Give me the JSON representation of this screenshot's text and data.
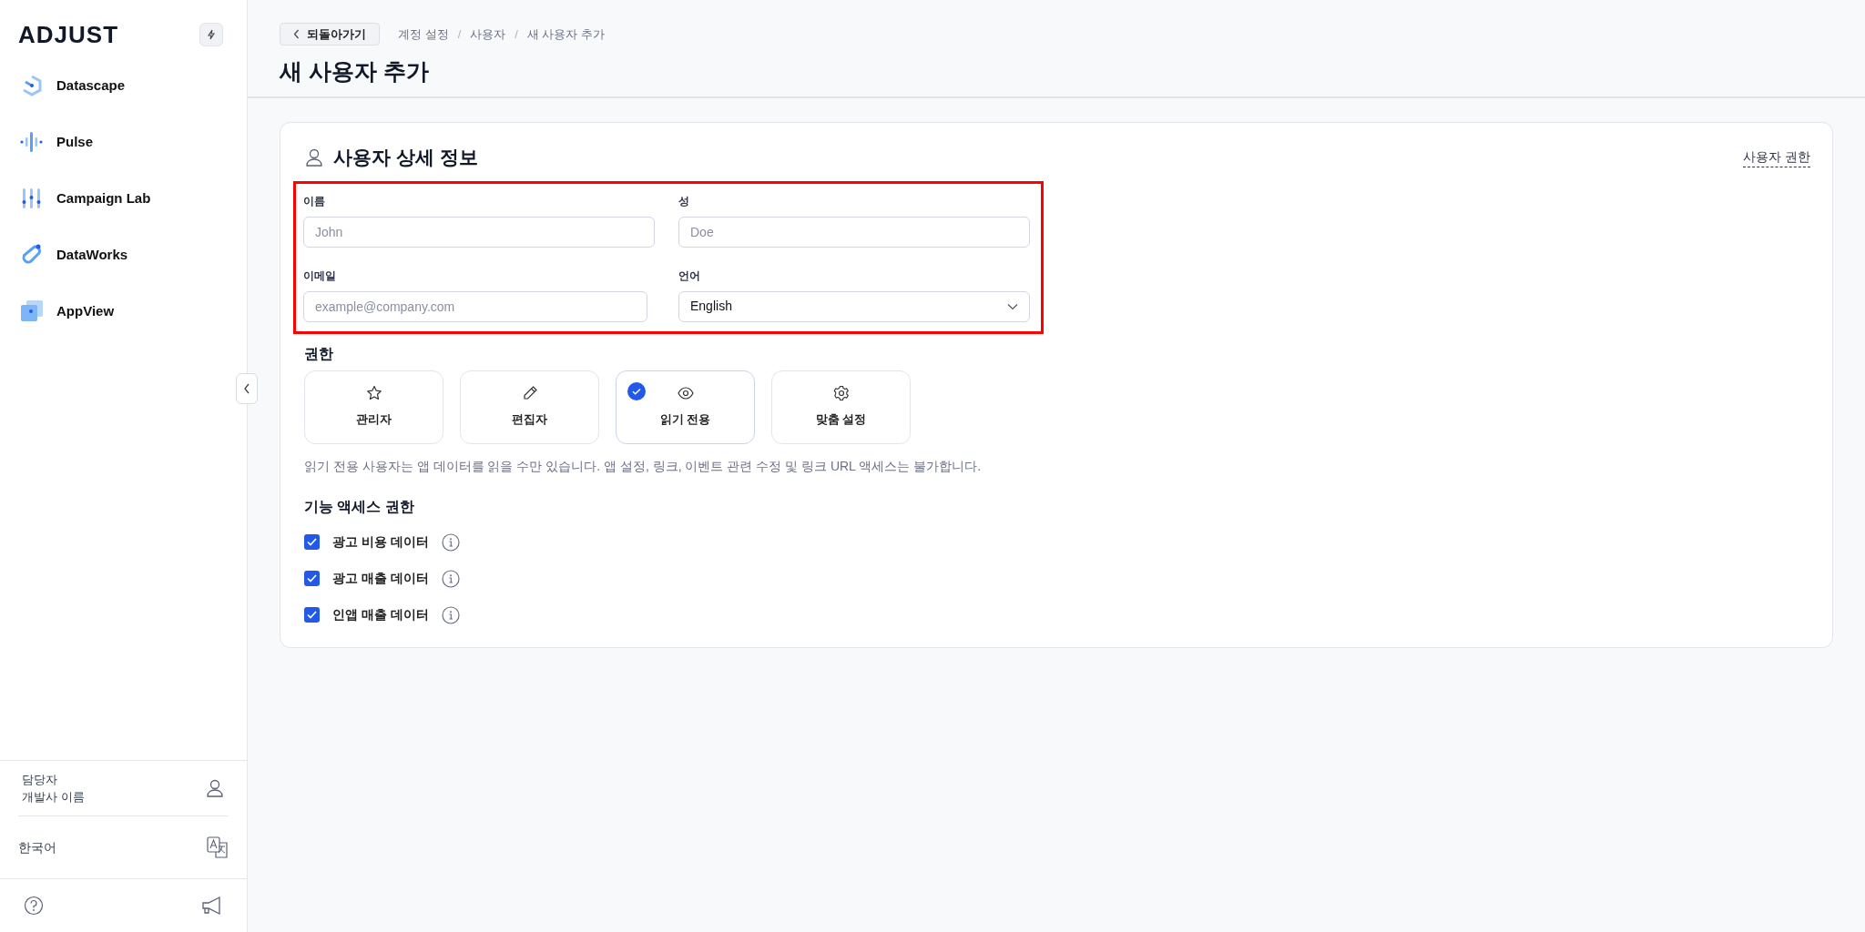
{
  "sidebar": {
    "logo": "ADJUST",
    "items": [
      {
        "label": "Datascape",
        "kind": "datascape"
      },
      {
        "label": "Pulse",
        "kind": "pulse"
      },
      {
        "label": "Campaign Lab",
        "kind": "campaign"
      },
      {
        "label": "DataWorks",
        "kind": "dataworks"
      },
      {
        "label": "AppView",
        "kind": "appview"
      }
    ],
    "account": {
      "role": "담당자",
      "name": "개발사 이름"
    },
    "language": "한국어"
  },
  "header": {
    "back": "되돌아가기",
    "breadcrumbs": [
      "계정 설정",
      "사용자",
      "새 사용자 추가"
    ],
    "separator": "/",
    "title": "새 사용자 추가"
  },
  "card": {
    "title": "사용자 상세 정보",
    "link": "사용자 권한",
    "fields": [
      {
        "label": "이름",
        "placeholder": "John",
        "kind": "text"
      },
      {
        "label": "성",
        "placeholder": "Doe",
        "kind": "text"
      },
      {
        "label": "이메일",
        "placeholder": "example@company.com",
        "kind": "text"
      },
      {
        "label": "언어",
        "value": "English",
        "kind": "select"
      }
    ],
    "roles_title": "권한",
    "roles": [
      {
        "label": "관리자",
        "kind": "star",
        "selected": false
      },
      {
        "label": "편집자",
        "kind": "pencil",
        "selected": false
      },
      {
        "label": "읽기 전용",
        "kind": "eye",
        "selected": true
      },
      {
        "label": "맞춤 설정",
        "kind": "gear",
        "selected": false
      }
    ],
    "role_description": "읽기 전용 사용자는 앱 데이터를 읽을 수만 있습니다. 앱 설정, 링크, 이벤트 관련 수정 및 링크 URL 액세스는 불가합니다.",
    "features_title": "기능 액세스 권한",
    "features": [
      {
        "label": "광고 비용 데이터",
        "checked": true
      },
      {
        "label": "광고 매출 데이터",
        "checked": true
      },
      {
        "label": "인앱 매출 데이터",
        "checked": true
      }
    ]
  }
}
